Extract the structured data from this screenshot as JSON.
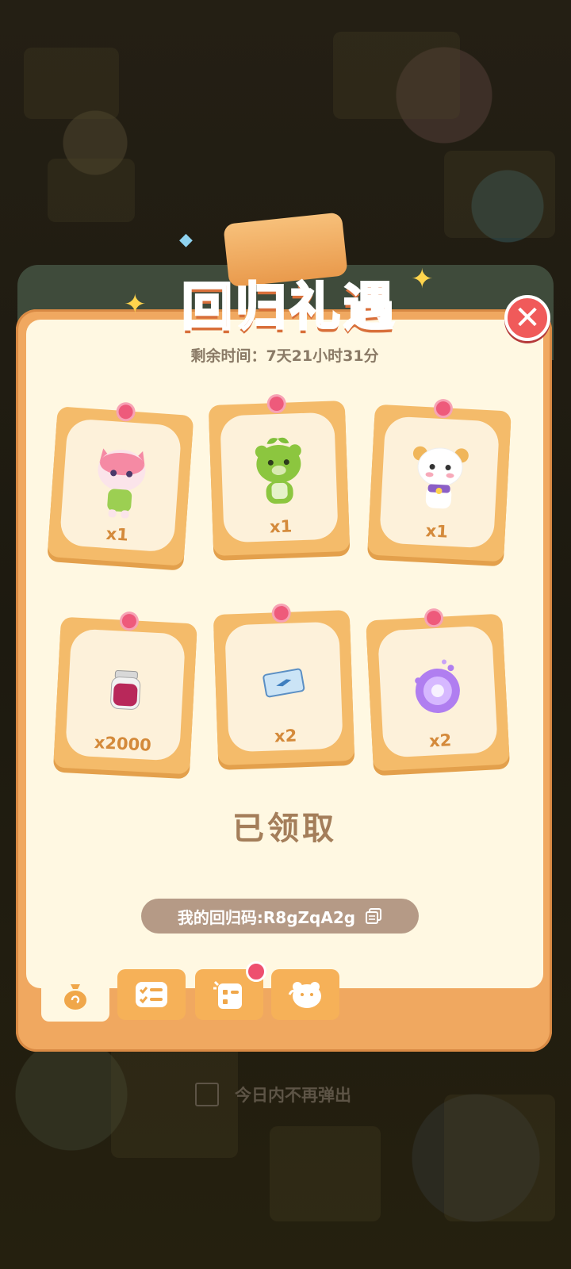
{
  "popup": {
    "title": "回归礼遇",
    "timer_label": "剩余时间：7天21小时31分",
    "status": "已领取",
    "return_code_label": "我的回归码:R8gZqA2g",
    "dont_show_label": "今日内不再弹出"
  },
  "rewards": [
    {
      "item": "pink-cat-character",
      "qty": "x1"
    },
    {
      "item": "green-sprout-bear-character",
      "qty": "x1"
    },
    {
      "item": "white-sheep-character",
      "qty": "x1"
    },
    {
      "item": "jam-jar-icon",
      "qty": "x2000"
    },
    {
      "item": "blue-ticket-icon",
      "qty": "x2"
    },
    {
      "item": "purple-crystal-orb-icon",
      "qty": "x2"
    }
  ],
  "tabs": [
    {
      "icon": "money-bag-icon",
      "active": true
    },
    {
      "icon": "checklist-icon",
      "active": false
    },
    {
      "icon": "task-board-icon",
      "active": false,
      "badge": true
    },
    {
      "icon": "bear-face-icon",
      "active": false
    }
  ],
  "colors": {
    "panel": "#f0a860",
    "inner": "#fff8e2",
    "close": "#f05a5a",
    "pin": "#ee5a7b",
    "qty_text": "#d48a3b"
  }
}
